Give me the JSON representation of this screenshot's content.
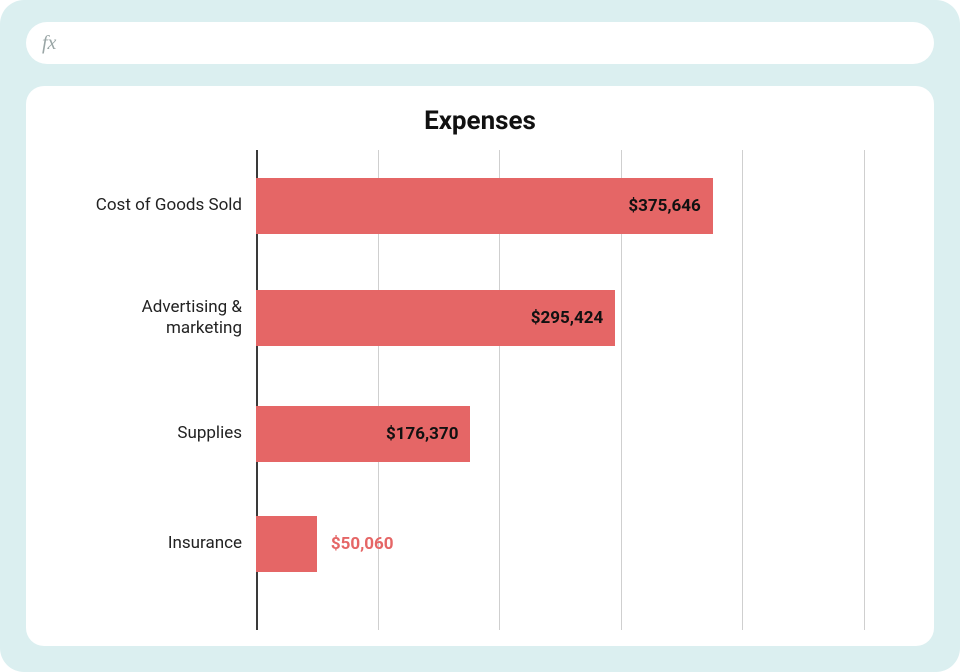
{
  "formula_bar": {
    "fx": "fx"
  },
  "chart_data": {
    "type": "bar",
    "orientation": "horizontal",
    "title": "Expenses",
    "categories": [
      "Cost of Goods Sold",
      "Advertising & marketing",
      "Supplies",
      "Insurance"
    ],
    "values": [
      375646,
      295424,
      176370,
      50060
    ],
    "value_labels": [
      "$375,646",
      "$295,424",
      "$176,370",
      "$50,060"
    ],
    "xlim": [
      0,
      500000
    ],
    "grid_ticks": [
      0,
      100000,
      200000,
      300000,
      400000,
      500000
    ],
    "bar_color": "#e56666",
    "label_inside": [
      true,
      true,
      true,
      false
    ]
  }
}
